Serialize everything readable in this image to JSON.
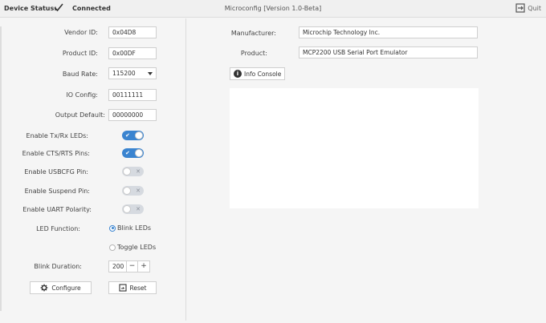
{
  "topbar": {
    "device_status_label": "Device Status:",
    "connected_text": "Connected",
    "title": "Microconfig [Version 1.0-Beta]",
    "quit_label": "Quit"
  },
  "left": {
    "vendor_id": {
      "label": "Vendor ID:",
      "value": "0x04D8"
    },
    "product_id": {
      "label": "Product ID:",
      "value": "0x00DF"
    },
    "baud_rate": {
      "label": "Baud Rate:",
      "value": "115200"
    },
    "io_config": {
      "label": "IO Config:",
      "value": "00111111"
    },
    "output_default": {
      "label": "Output Default:",
      "value": "00000000"
    },
    "toggles": [
      {
        "label": "Enable Tx/Rx LEDs:",
        "state": "on",
        "mark": "✔"
      },
      {
        "label": "Enable CTS/RTS Pins:",
        "state": "on",
        "mark": "✔"
      },
      {
        "label": "Enable USBCFG Pin:",
        "state": "off",
        "mark": "✕"
      },
      {
        "label": "Enable Suspend Pin:",
        "state": "off",
        "mark": "✕"
      },
      {
        "label": "Enable UART Polarity:",
        "state": "off",
        "mark": "✕"
      }
    ],
    "led_function": {
      "label": "LED Function:",
      "options": [
        {
          "label": "Blink LEDs",
          "selected": true
        },
        {
          "label": "Toggle LEDs",
          "selected": false
        }
      ]
    },
    "blink_duration": {
      "label": "Blink Duration:",
      "value": "200",
      "minus": "−",
      "plus": "+"
    },
    "configure_label": "Configure",
    "reset_label": "Reset"
  },
  "right": {
    "manufacturer": {
      "label": "Manufacturer:",
      "value": "Microchip Technology Inc."
    },
    "product": {
      "label": "Product:",
      "value": "MCP2200 USB Serial Port Emulator"
    },
    "info_console_label": "Info Console",
    "info_icon_glyph": "i"
  },
  "colors": {
    "accent": "#3a84d0",
    "toggle_off": "#d6dae0",
    "background": "#f5f5f5"
  }
}
